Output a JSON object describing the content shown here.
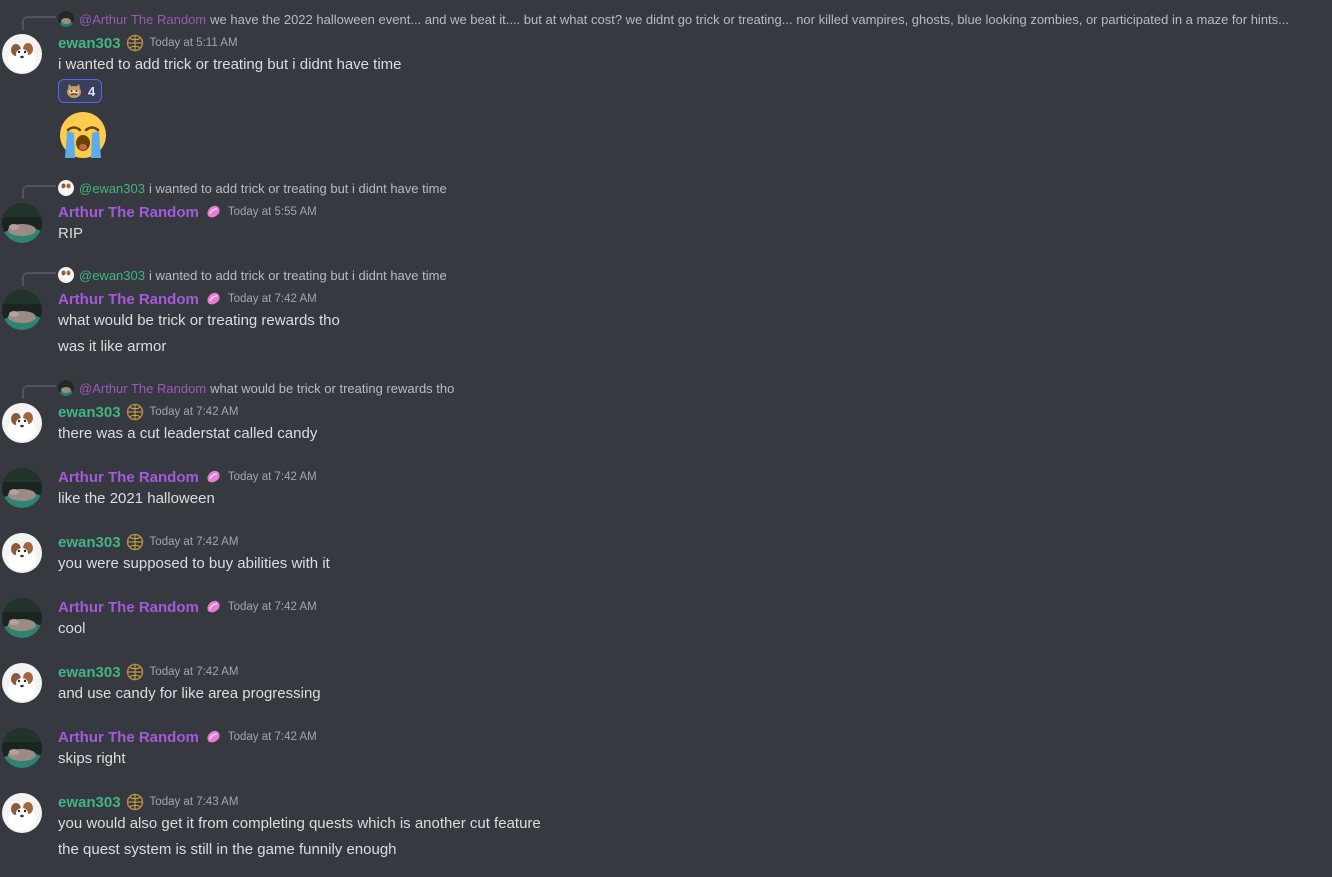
{
  "users": {
    "ewan": {
      "name": "ewan303",
      "color": "#43b581"
    },
    "arthur": {
      "name": "Arthur The Random",
      "color": "#a55adb"
    }
  },
  "icons": {
    "ewan_badge": "globe-badge-icon",
    "arthur_badge": "pink-gem-badge-icon",
    "reaction_emoji": "crying-cat-emoji-icon",
    "big_emoji": "loudly-crying-face-emoji"
  },
  "messages": [
    {
      "reply": {
        "mention": "@Arthur The Random",
        "text": "we have the 2022 halloween event... and we beat it.... but at what cost? we didnt go trick or treating... nor killed vampires, ghosts, blue looking zombies, or participated in a maze for hints..."
      },
      "author": "ewan303",
      "timestamp": "Today at 5:11 AM",
      "lines": [
        "i wanted to add trick or treating but i didnt have time"
      ],
      "reaction": {
        "count": "4"
      }
    },
    {
      "reply": {
        "mention": "@ewan303",
        "text": "i wanted to add trick or treating but i didnt have time"
      },
      "author": "Arthur The Random",
      "timestamp": "Today at 5:55 AM",
      "lines": [
        "RIP"
      ]
    },
    {
      "reply": {
        "mention": "@ewan303",
        "text": "i wanted to add trick or treating but i didnt have time"
      },
      "author": "Arthur The Random",
      "timestamp": "Today at 7:42 AM",
      "lines": [
        "what would be trick or treating rewards tho",
        "was it like armor"
      ]
    },
    {
      "reply": {
        "mention": "@Arthur The Random",
        "text": "what would be trick or treating rewards tho"
      },
      "author": "ewan303",
      "timestamp": "Today at 7:42 AM",
      "lines": [
        "there was a cut leaderstat called candy"
      ]
    },
    {
      "author": "Arthur The Random",
      "timestamp": "Today at 7:42 AM",
      "lines": [
        "like the 2021 halloween"
      ]
    },
    {
      "author": "ewan303",
      "timestamp": "Today at 7:42 AM",
      "lines": [
        "you were supposed to buy abilities with it"
      ]
    },
    {
      "author": "Arthur The Random",
      "timestamp": "Today at 7:42 AM",
      "lines": [
        "cool"
      ]
    },
    {
      "author": "ewan303",
      "timestamp": "Today at 7:42 AM",
      "lines": [
        "and use candy for like area progressing"
      ]
    },
    {
      "author": "Arthur The Random",
      "timestamp": "Today at 7:42 AM",
      "lines": [
        "skips right"
      ]
    },
    {
      "author": "ewan303",
      "timestamp": "Today at 7:43 AM",
      "lines": [
        "you would also get it from completing quests which is another cut feature",
        "the quest system is still in the game funnily enough"
      ]
    }
  ]
}
